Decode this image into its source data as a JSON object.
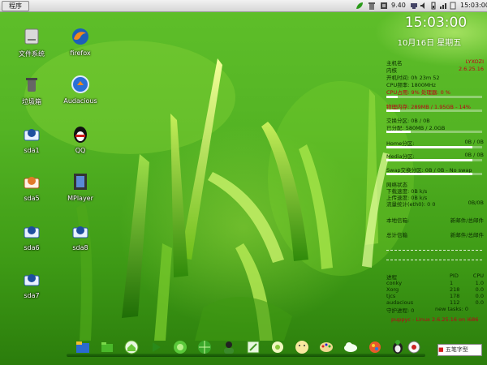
{
  "panel": {
    "menu_label": "程序",
    "network_speed": "9.40",
    "clock_text": "15:03:00",
    "icons": [
      "leaf-icon",
      "trash-icon",
      "chip-icon",
      "network-icon",
      "speaker-icon",
      "battery-icon",
      "signal-icon",
      "clipboard-icon"
    ]
  },
  "desktop_icons": [
    {
      "label": "文件系统",
      "icon": "drive-icon"
    },
    {
      "label": "firefox",
      "icon": "firefox-icon"
    },
    {
      "label": "垃圾箱",
      "icon": "trash-icon"
    },
    {
      "label": "Audacious",
      "icon": "audacious-icon"
    },
    {
      "label": "sda1",
      "icon": "drive-icon"
    },
    {
      "label": "QQ",
      "icon": "penguin-icon"
    },
    {
      "label": "sda5",
      "icon": "drive-icon"
    },
    {
      "label": "MPlayer",
      "icon": "film-icon"
    },
    {
      "label": "sda6",
      "icon": "drive-icon"
    },
    {
      "label": "sda8",
      "icon": "drive-icon"
    },
    {
      "label": "sda7",
      "icon": "drive-icon"
    }
  ],
  "conky": {
    "time": "15:03:00",
    "date": "10月16日 星期五",
    "sysinfo": [
      {
        "label": "主机名",
        "value": "LYXOZI"
      },
      {
        "label": "内核",
        "value": "2.6.25.16"
      },
      {
        "label": "开机时间: 0h 23m 52",
        "value": ""
      },
      {
        "label": "CPU频率: 1800MHz",
        "value": ""
      },
      {
        "label": "CPU占用: 9% 处理器: 0 %",
        "value": ""
      }
    ],
    "mem_label": "物理内存: 289MB / 1.95GB - 14%",
    "mem_fraction": 0.14,
    "swap_label": "交换分区: 0B / 0B",
    "swap_sub": "已分配: 580MB / 2.0GB",
    "swap_fraction": 0.25,
    "home_label": "Home分区:",
    "home_value": "0B / 0B",
    "home_fraction": 0.9,
    "media_label": "Media分区:",
    "media_value": "0B / 0B",
    "media_fraction": 0.9,
    "swapdisk_label": "Swap交换分区: 0B / 0B - No swap",
    "swapdisk_fraction": 0.9,
    "net_title": "网络状态",
    "net_lines": [
      "下载速度: 0B k/s",
      "上传速度: 0B k/s",
      "流量统计(eth0): 0 0"
    ],
    "net_right": "0B/0B",
    "mail_label": "本地信箱:",
    "mail_value": "新邮件/总邮件",
    "mail_sub": "总计信箱",
    "mail_sub_value": "新邮件/总邮件",
    "proc_header": [
      "进程",
      "PID",
      "CPU"
    ],
    "proc_rows": [
      [
        "conky",
        "1",
        "1.0"
      ],
      [
        "Xorg",
        "218",
        "0.0"
      ],
      [
        "tjcs",
        "178",
        "0.0"
      ],
      [
        "audacious",
        "112",
        "0.0"
      ],
      [
        "守护进程: 0",
        "new tasks: 0",
        ""
      ]
    ],
    "footer": "puppyc - Linux 2.6.25.16 on i686"
  },
  "dock_items": [
    "folder-icon",
    "folder-icon",
    "home-icon",
    "play-icon",
    "globe-icon",
    "globe-icon",
    "user-icon",
    "camera-icon",
    "gear-icon",
    "face-icon",
    "palette-icon",
    "cloud-icon",
    "paint-icon",
    "penguin-icon",
    "bell-icon"
  ],
  "tray_button": "五笔字型"
}
